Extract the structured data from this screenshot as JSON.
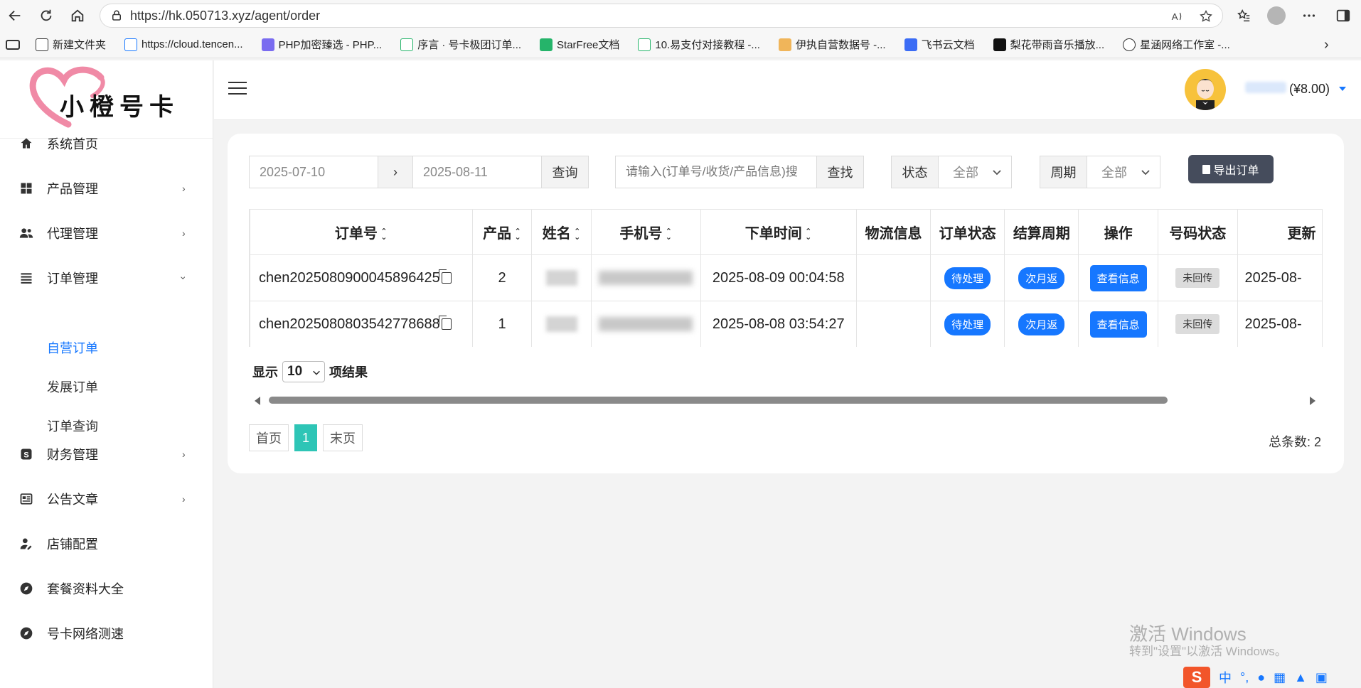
{
  "browser": {
    "url": "https://hk.050713.xyz/agent/order",
    "bookmarks": [
      {
        "label": "新建文件夹",
        "icon": "folder-icon"
      },
      {
        "label": "https://cloud.tencen...",
        "icon": "cloud-icon"
      },
      {
        "label": "PHP加密臻选 - PHP...",
        "icon": "php-icon"
      },
      {
        "label": "序言 · 号卡极团订单...",
        "icon": "book-icon"
      },
      {
        "label": "StarFree文档",
        "icon": "leaf-icon"
      },
      {
        "label": "10.易支付对接教程 -...",
        "icon": "book-icon"
      },
      {
        "label": "伊执自营数据号 -...",
        "icon": "avatar-icon"
      },
      {
        "label": "飞书云文档",
        "icon": "doc-icon"
      },
      {
        "label": "梨花带雨音乐播放...",
        "icon": "music-icon"
      },
      {
        "label": "星涵网络工作室 -...",
        "icon": "globe-icon"
      }
    ]
  },
  "sidebar": {
    "logo_text": "小橙号卡",
    "items": [
      {
        "label": "系统首页",
        "icon": "home-icon",
        "arrow": ""
      },
      {
        "label": "产品管理",
        "icon": "grid-icon",
        "arrow": "›"
      },
      {
        "label": "代理管理",
        "icon": "users-icon",
        "arrow": "›"
      },
      {
        "label": "订单管理",
        "icon": "list-icon",
        "arrow": "›"
      },
      {
        "label": "财务管理",
        "icon": "dollar-icon",
        "arrow": "›"
      },
      {
        "label": "公告文章",
        "icon": "news-icon",
        "arrow": "›"
      },
      {
        "label": "店铺配置",
        "icon": "user-cog-icon",
        "arrow": ""
      },
      {
        "label": "套餐资料大全",
        "icon": "compass-icon",
        "arrow": ""
      },
      {
        "label": "号卡网络测速",
        "icon": "compass-icon",
        "arrow": ""
      }
    ],
    "sub_items": [
      "自营订单",
      "发展订单",
      "订单查询"
    ]
  },
  "header": {
    "balance": "(¥8.00)"
  },
  "filters": {
    "date_start": "2025-07-10",
    "date_sep": "›",
    "date_end": "2025-08-11",
    "query_btn": "查询",
    "search_placeholder": "请输入(订单号/收货/产品信息)搜",
    "search_btn": "查找",
    "status_label": "状态",
    "status_value": "全部",
    "period_label": "周期",
    "period_value": "全部",
    "export_btn": "导出订单"
  },
  "table": {
    "columns": [
      "订单号",
      "产品",
      "姓名",
      "手机号",
      "下单时间",
      "物流信息",
      "订单状态",
      "结算周期",
      "操作",
      "号码状态",
      "更新"
    ],
    "rows": [
      {
        "order_no": "chen2025080900045896425",
        "product": "2",
        "time": "2025-08-09 00:04:58",
        "status": "待处理",
        "period": "次月返",
        "action": "查看信息",
        "number_status": "未回传",
        "updated": "2025-08-"
      },
      {
        "order_no": "chen2025080803542778688",
        "product": "1",
        "time": "2025-08-08 03:54:27",
        "status": "待处理",
        "period": "次月返",
        "action": "查看信息",
        "number_status": "未回传",
        "updated": "2025-08-"
      }
    ]
  },
  "pagination": {
    "show_prefix": "显示",
    "page_size": "10",
    "show_suffix": "项结果",
    "first": "首页",
    "current": "1",
    "last": "末页",
    "total": "总条数: 2"
  },
  "watermark": {
    "line1": "激活 Windows",
    "line2": "转到\"设置\"以激活 Windows。"
  },
  "tray": {
    "ime": "中",
    "sogou": "S"
  },
  "colors": {
    "primary": "#1677ff",
    "export": "#454c5c",
    "page_active": "#2ec5b6"
  }
}
